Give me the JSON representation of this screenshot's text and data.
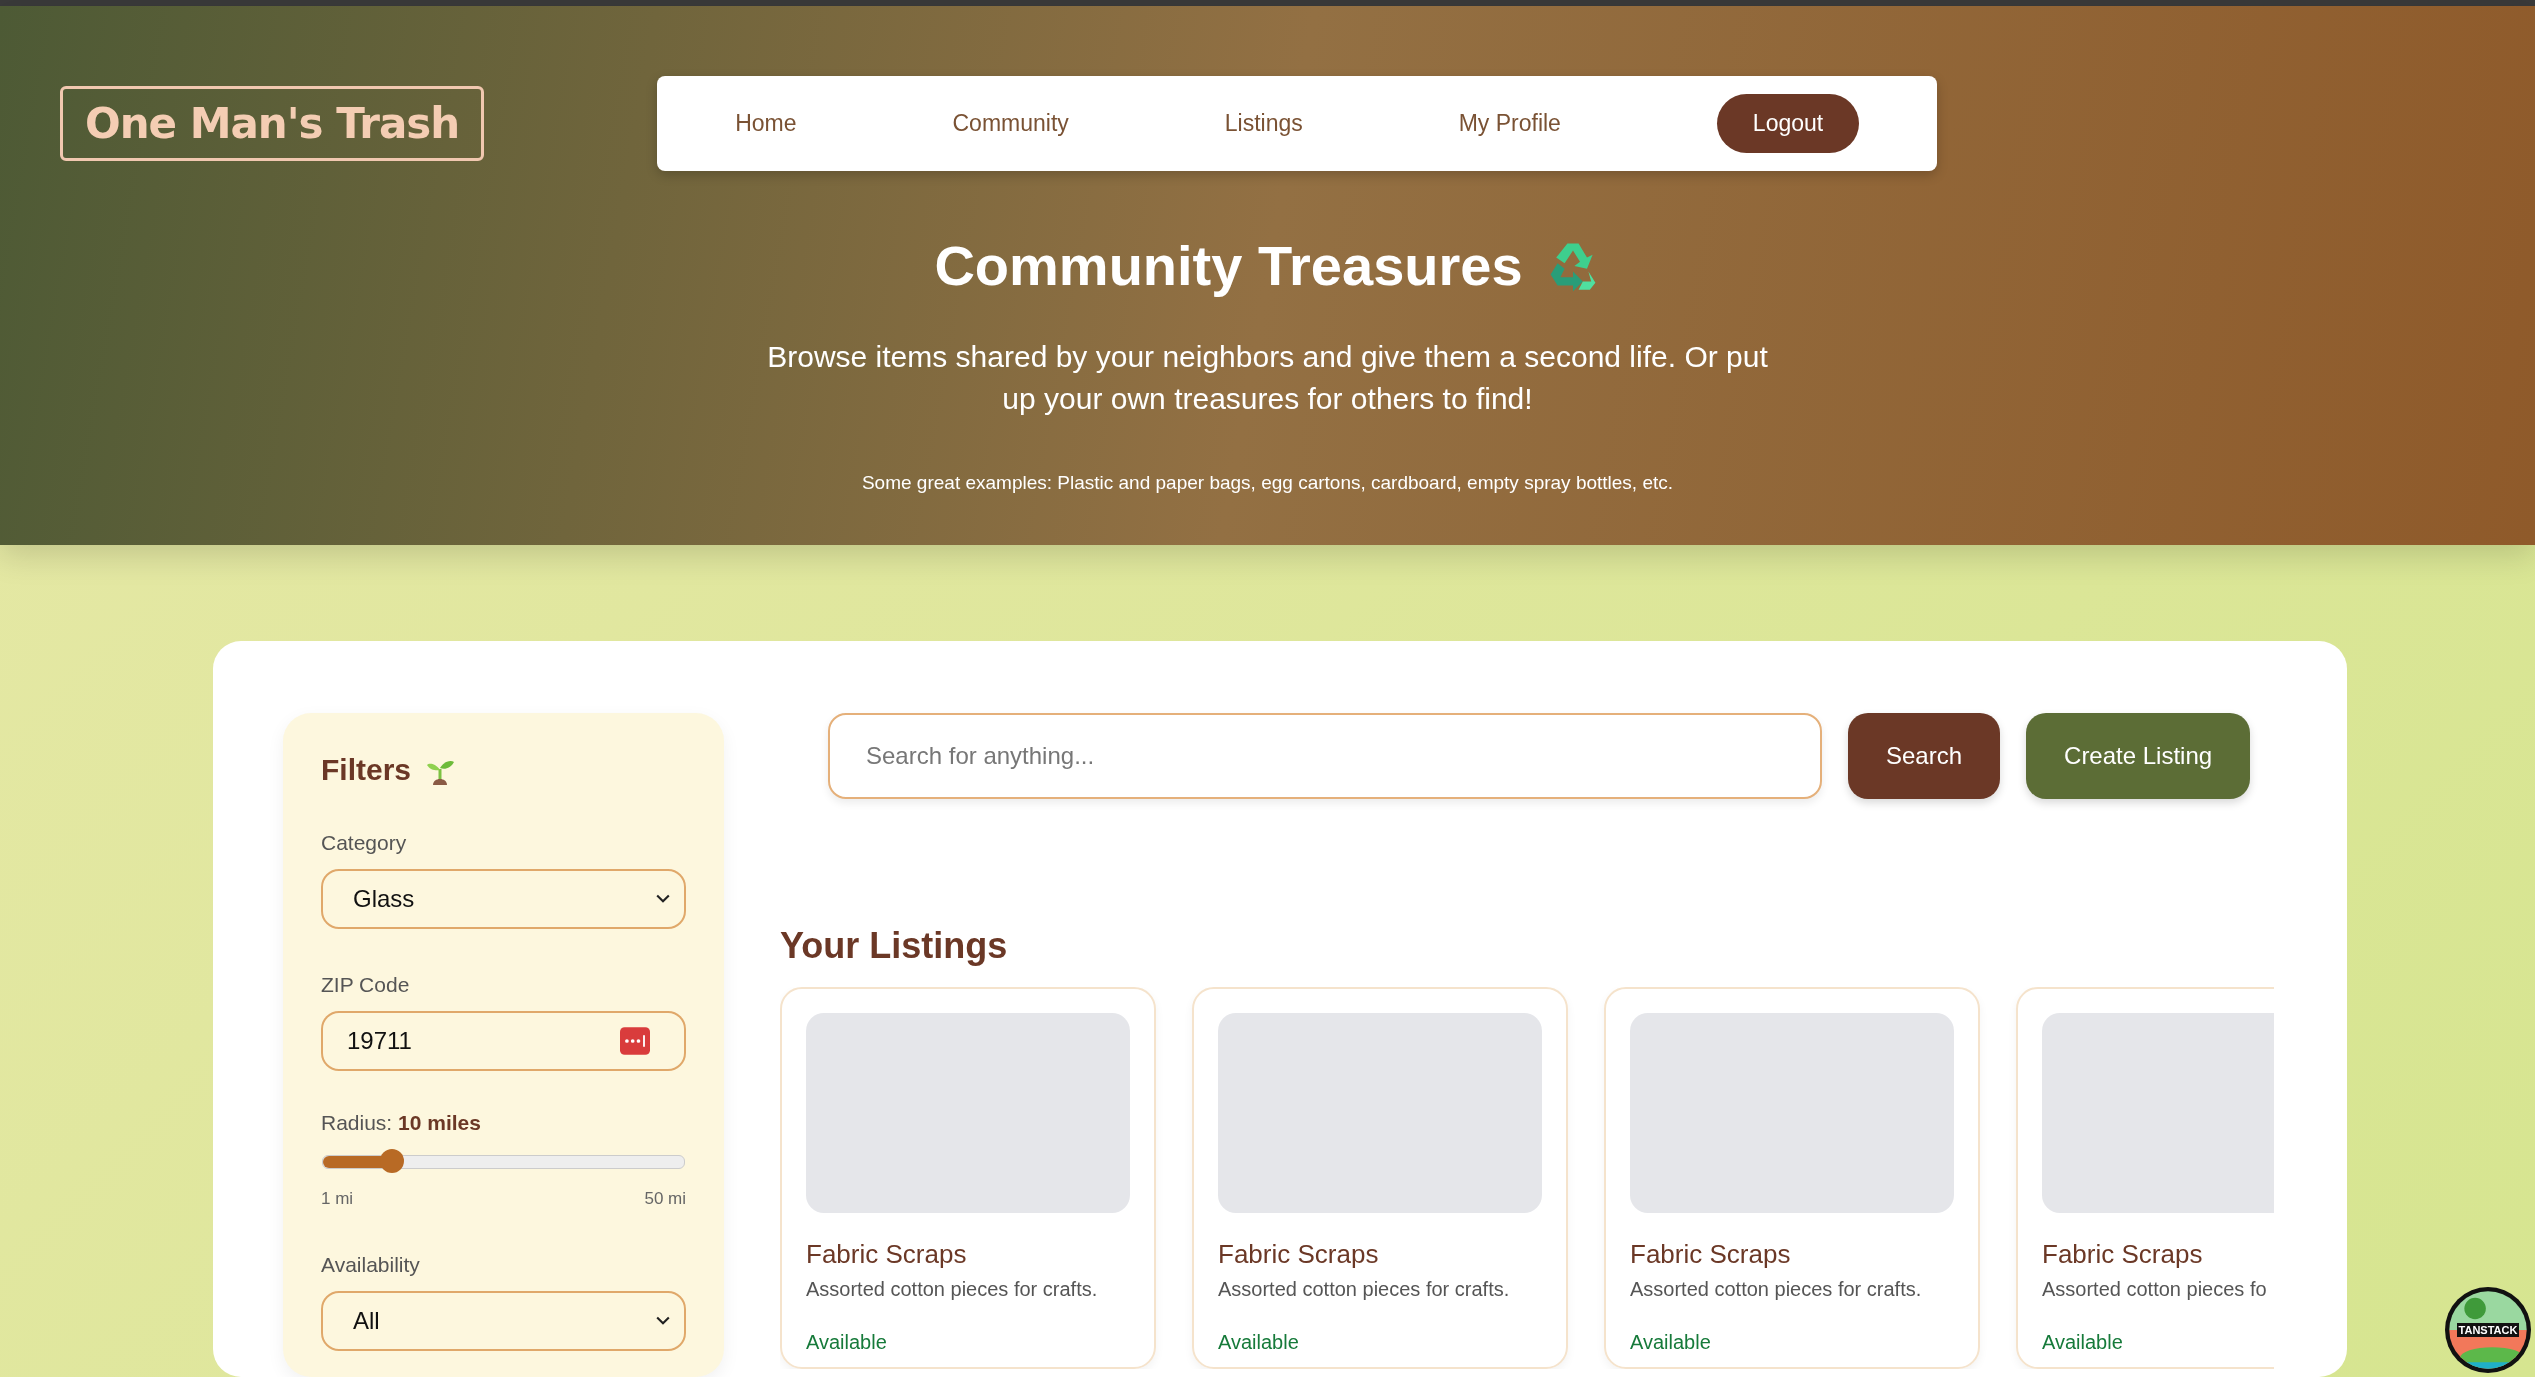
{
  "logo": {
    "text": "One Man's Trash"
  },
  "nav": {
    "items": [
      {
        "label": "Home",
        "kind": "link"
      },
      {
        "label": "Community",
        "kind": "link"
      },
      {
        "label": "Listings",
        "kind": "link"
      },
      {
        "label": "My Profile",
        "kind": "link"
      },
      {
        "label": "Logout",
        "kind": "button"
      }
    ]
  },
  "hero": {
    "title": "Community Treasures",
    "subtitle": "Browse items shared by your neighbors and give them a second life. Or put up your own treasures for others to find!",
    "examples": "Some great examples: Plastic and paper bags, egg cartons, cardboard, empty spray bottles, etc."
  },
  "filters": {
    "title": "Filters",
    "category": {
      "label": "Category",
      "value": "Glass"
    },
    "zip": {
      "label": "ZIP Code",
      "value": "19711"
    },
    "radius": {
      "label": "Radius: **10 miles**",
      "level": 0.19,
      "min": "1 mi",
      "max": "50 mi"
    },
    "availability": {
      "label": "Availability",
      "value": "All"
    }
  },
  "search": {
    "placeholder": "Search for anything...",
    "button": "Search",
    "create": "Create Listing"
  },
  "listings": {
    "title": "Your Listings",
    "items": [
      {
        "title": "Fabric Scraps",
        "description": "Assorted cotton pieces for crafts.",
        "status": "Available"
      },
      {
        "title": "Fabric Scraps",
        "description": "Assorted cotton pieces for crafts.",
        "status": "Available"
      },
      {
        "title": "Fabric Scraps",
        "description": "Assorted cotton pieces for crafts.",
        "status": "Available"
      },
      {
        "title": "Fabric Scraps",
        "description": "Assorted cotton pieces fo",
        "status": "Available"
      }
    ]
  },
  "badge": {
    "label": "TANSTACK"
  }
}
